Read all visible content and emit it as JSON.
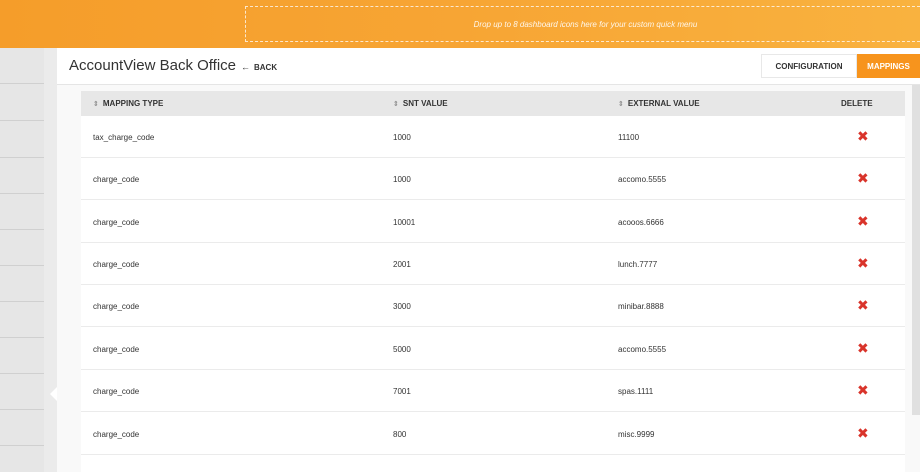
{
  "topbar": {
    "dropzone_text": "Drop up to 8 dashboard icons here for your custom quick menu"
  },
  "header": {
    "title": "AccountView Back Office",
    "back_label": "BACK",
    "tabs": [
      {
        "label": "CONFIGURATION",
        "active": false
      },
      {
        "label": "MAPPINGS",
        "active": true
      }
    ]
  },
  "table": {
    "columns": [
      "MAPPING TYPE",
      "SNT VALUE",
      "EXTERNAL VALUE",
      "DELETE"
    ],
    "rows": [
      {
        "mapping_type": "tax_charge_code",
        "snt_value": "1000",
        "external_value": "11100"
      },
      {
        "mapping_type": "charge_code",
        "snt_value": "1000",
        "external_value": "accomo.5555"
      },
      {
        "mapping_type": "charge_code",
        "snt_value": "10001",
        "external_value": "acooos.6666"
      },
      {
        "mapping_type": "charge_code",
        "snt_value": "2001",
        "external_value": "lunch.7777"
      },
      {
        "mapping_type": "charge_code",
        "snt_value": "3000",
        "external_value": "minibar.8888"
      },
      {
        "mapping_type": "charge_code",
        "snt_value": "5000",
        "external_value": "accomo.5555"
      },
      {
        "mapping_type": "charge_code",
        "snt_value": "7001",
        "external_value": "spas.1111"
      },
      {
        "mapping_type": "charge_code",
        "snt_value": "800",
        "external_value": "misc.9999"
      }
    ],
    "delete_icon": "delete-x-icon"
  },
  "colors": {
    "accent_orange": "#f7941d",
    "delete_red": "#d9342b"
  }
}
